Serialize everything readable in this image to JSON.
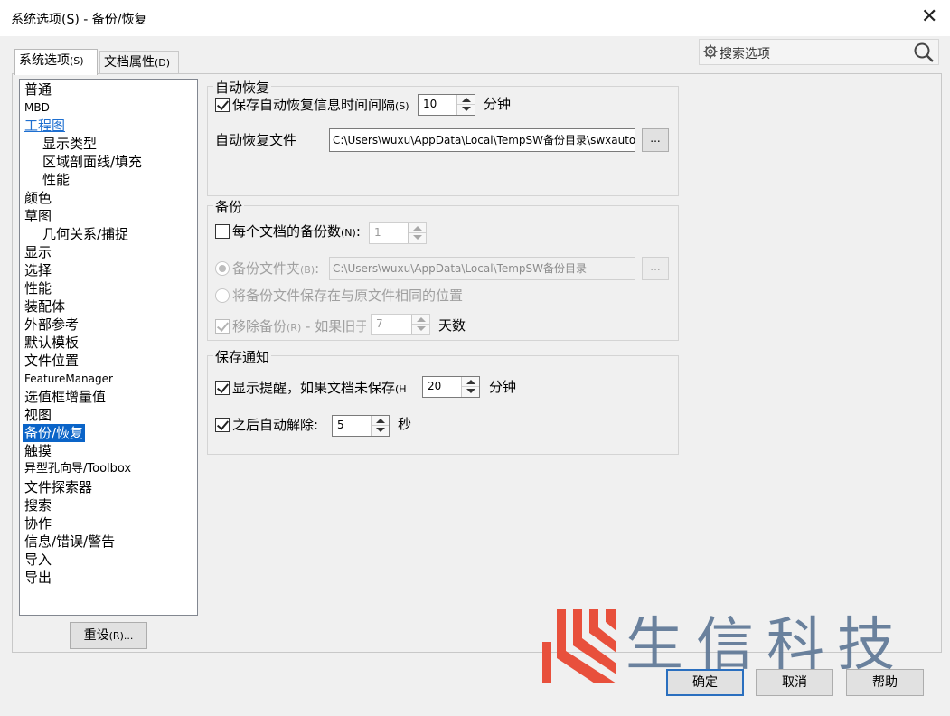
{
  "window": {
    "title": "系统选项(S) - 备份/恢复",
    "close_glyph": "✕"
  },
  "tabs": [
    {
      "label": "系统选项",
      "key": "(S)"
    },
    {
      "label": "文档属性",
      "key": "(D)"
    }
  ],
  "search": {
    "placeholder": "搜索选项",
    "icon": "gear-icon",
    "search_icon": "magnifier-icon"
  },
  "tree": {
    "items": [
      {
        "label": "普通"
      },
      {
        "label": "MBD"
      },
      {
        "label": "工程图"
      },
      {
        "label": "显示类型"
      },
      {
        "label": "区域剖面线/填充"
      },
      {
        "label": "性能"
      },
      {
        "label": "颜色"
      },
      {
        "label": "草图"
      },
      {
        "label": "几何关系/捕捉"
      },
      {
        "label": "显示"
      },
      {
        "label": "选择"
      },
      {
        "label": "性能"
      },
      {
        "label": "装配体"
      },
      {
        "label": "外部参考"
      },
      {
        "label": "默认模板"
      },
      {
        "label": "文件位置"
      },
      {
        "label": "FeatureManager"
      },
      {
        "label": "选值框增量值"
      },
      {
        "label": "视图"
      },
      {
        "label": "备份/恢复"
      },
      {
        "label": "触摸"
      },
      {
        "label": "异型孔向导/Toolbox"
      },
      {
        "label": "文件探索器"
      },
      {
        "label": "搜索"
      },
      {
        "label": "协作"
      },
      {
        "label": "信息/错误/警告"
      },
      {
        "label": "导入"
      },
      {
        "label": "导出"
      }
    ],
    "selected": "备份/恢复"
  },
  "reset_button": {
    "label": "重设",
    "key": "(R)..."
  },
  "autorecover": {
    "group_label": "自动恢复",
    "save_label": "保存自动恢复信息时间间隔",
    "save_key": "(S)",
    "save_checked": true,
    "interval_value": "10",
    "interval_unit": "分钟",
    "file_label": "自动恢复文件",
    "file_path": "C:\\Users\\wuxu\\AppData\\Local\\TempSW备份目录\\swxauto",
    "browse_label": "..."
  },
  "backup": {
    "group_label": "备份",
    "count_label": "每个文档的备份数",
    "count_key": "(N)",
    "count_checked": false,
    "count_value": "1",
    "folder_label": "备份文件夹",
    "folder_key": "(B)",
    "folder_path": "C:\\Users\\wuxu\\AppData\\Local\\TempSW备份目录",
    "browse_label": "...",
    "same_location_label": "将备份文件保存在与原文件相同的位置",
    "remove_label": "移除备份",
    "remove_key": "(R)",
    "remove_suffix": " - 如果旧于",
    "remove_checked": true,
    "remove_value": "7",
    "remove_unit": "天数"
  },
  "save_notice": {
    "group_label": "保存通知",
    "reminder_label": "显示提醒，如果文档未保存",
    "reminder_key": "(H",
    "reminder_checked": true,
    "reminder_value": "20",
    "reminder_unit": "分钟",
    "dismiss_label": "之后自动解除:",
    "dismiss_checked": true,
    "dismiss_value": "5",
    "dismiss_unit": "秒"
  },
  "footer": {
    "ok_label": "确定",
    "cancel_label": "取消",
    "help_label": "帮助"
  },
  "watermark": {
    "text": "生信科技",
    "logo_color": "#e8503c",
    "text_color": "#5f7896"
  }
}
